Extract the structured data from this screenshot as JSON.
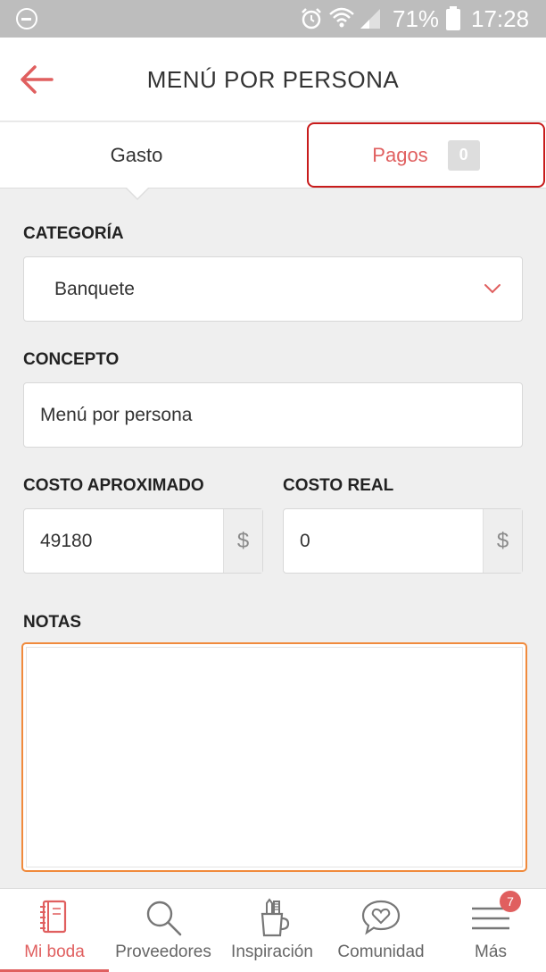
{
  "status_bar": {
    "battery": "71%",
    "time": "17:28"
  },
  "header": {
    "title": "MENÚ POR PERSONA"
  },
  "tabs": [
    {
      "label": "Gasto",
      "active": true
    },
    {
      "label": "Pagos",
      "count": "0",
      "active": false
    }
  ],
  "form": {
    "category": {
      "label": "CATEGORÍA",
      "value": "Banquete"
    },
    "concept": {
      "label": "CONCEPTO",
      "value": "Menú por persona"
    },
    "approx_cost": {
      "label": "COSTO APROXIMADO",
      "value": "49180",
      "currency": "$"
    },
    "real_cost": {
      "label": "COSTO REAL",
      "value": "0",
      "currency": "$"
    },
    "notes": {
      "label": "NOTAS",
      "value": ""
    }
  },
  "bottom_nav": [
    {
      "label": "Mi boda",
      "icon": "notebook-icon",
      "active": true
    },
    {
      "label": "Proveedores",
      "icon": "search-icon",
      "active": false
    },
    {
      "label": "Inspiración",
      "icon": "pencil-cup-icon",
      "active": false
    },
    {
      "label": "Comunidad",
      "icon": "chat-heart-icon",
      "active": false
    },
    {
      "label": "Más",
      "icon": "menu-icon",
      "badge": "7",
      "active": false
    }
  ],
  "colors": {
    "accent": "#e05f5f",
    "focus": "#f08a3c",
    "tab_outline": "#c81b1b"
  }
}
